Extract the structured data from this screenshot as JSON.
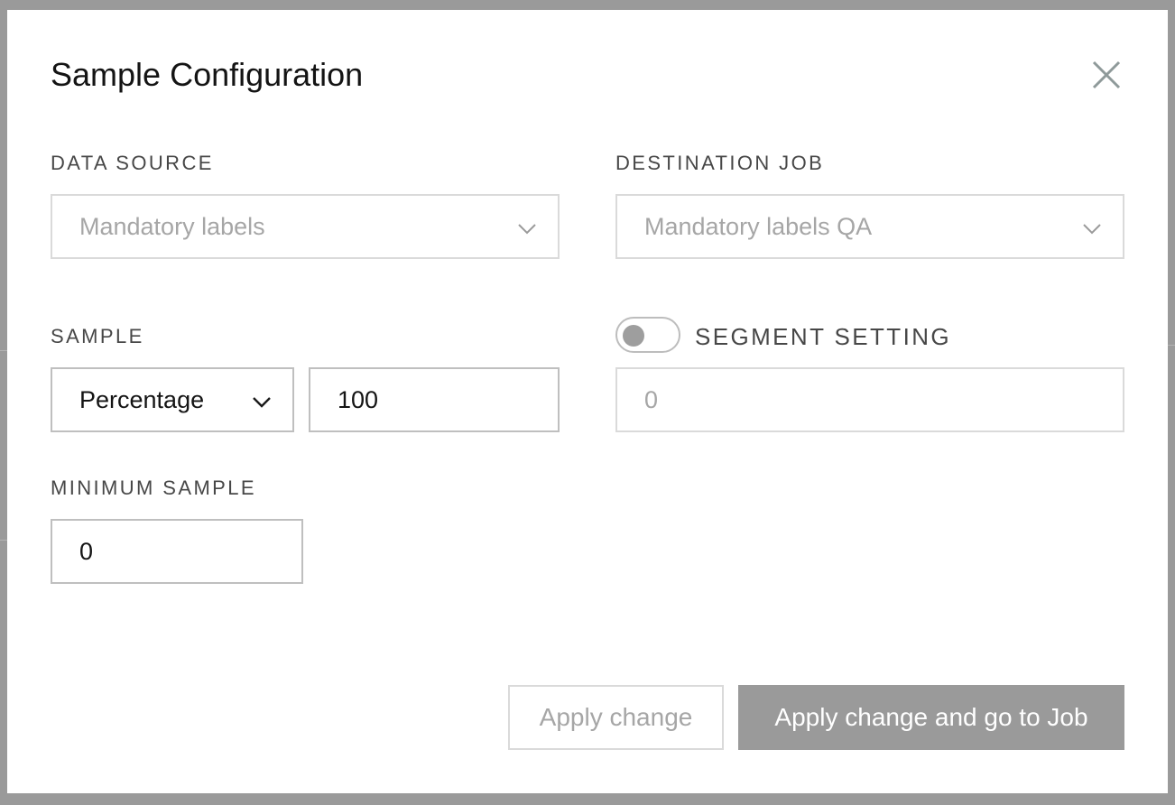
{
  "dialog": {
    "title": "Sample Configuration",
    "close_icon": "close-icon"
  },
  "data_source": {
    "label": "DATA SOURCE",
    "value": "Mandatory labels"
  },
  "destination_job": {
    "label": "DESTINATION JOB",
    "value": "Mandatory labels QA"
  },
  "sample": {
    "label": "SAMPLE",
    "type_value": "Percentage",
    "amount_value": "100"
  },
  "segment_setting": {
    "label": "SEGMENT SETTING",
    "enabled": false,
    "value": "0"
  },
  "minimum_sample": {
    "label": "MINIMUM SAMPLE",
    "value": "0"
  },
  "actions": {
    "apply_label": "Apply change",
    "apply_go_label": "Apply change and go to Job"
  },
  "colors": {
    "primary_button_bg": "#9a9a9a",
    "overlay": "#9a9a9a",
    "muted_text": "#a6a6a6"
  }
}
